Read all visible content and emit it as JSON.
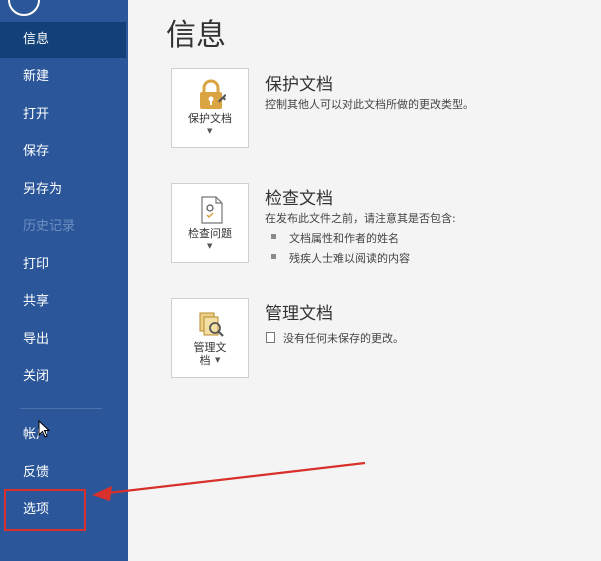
{
  "sidebar": {
    "items": [
      {
        "label": "信息",
        "selected": true
      },
      {
        "label": "新建"
      },
      {
        "label": "打开"
      },
      {
        "label": "保存"
      },
      {
        "label": "另存为"
      },
      {
        "label": "历史记录",
        "disabled": true
      },
      {
        "label": "打印"
      },
      {
        "label": "共享"
      },
      {
        "label": "导出"
      },
      {
        "label": "关闭"
      }
    ],
    "bottom_items": [
      {
        "label": "帐户"
      },
      {
        "label": "反馈"
      },
      {
        "label": "选项",
        "highlighted": true
      }
    ]
  },
  "main": {
    "title": "信息",
    "sections": [
      {
        "button_label": "保护文档",
        "title": "保护文档",
        "description": "控制其他人可以对此文档所做的更改类型。"
      },
      {
        "button_label": "检查问题",
        "title": "检查文档",
        "description": "在发布此文件之前，请注意其是否包含:",
        "bullets": [
          "文档属性和作者的姓名",
          "残疾人士难以阅读的内容"
        ]
      },
      {
        "button_label_line1": "管理文",
        "button_label_line2": "档",
        "title": "管理文档",
        "status": "没有任何未保存的更改。"
      }
    ]
  },
  "colors": {
    "sidebar": "#2b579a",
    "sidebar_selected": "#124078",
    "annotation": "#d8302a",
    "tile_icon": "#d9a441"
  }
}
